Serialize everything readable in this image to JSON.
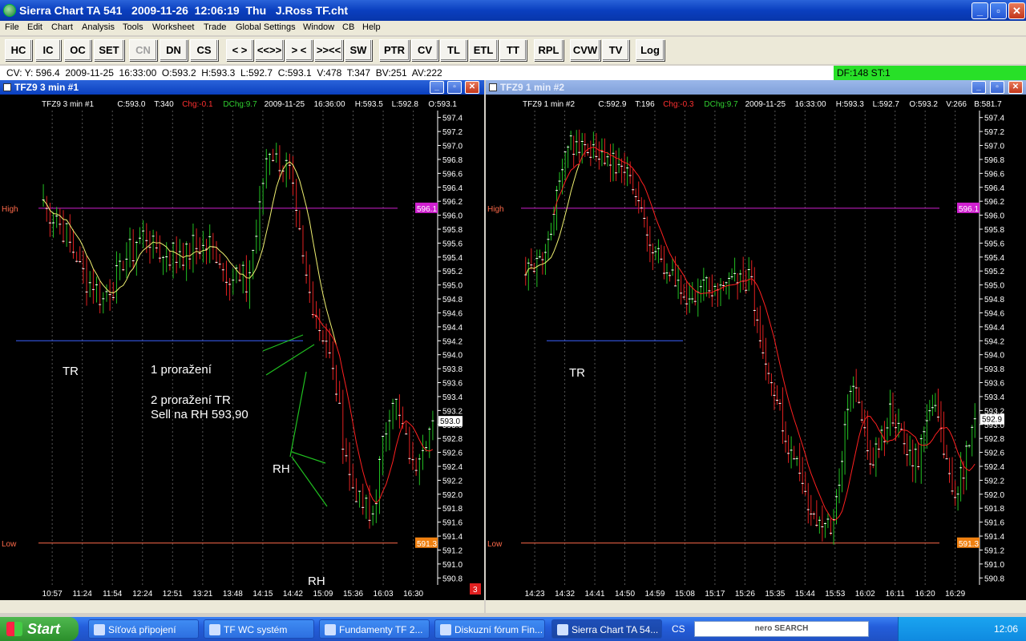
{
  "window": {
    "title": "Sierra Chart TA 541   2009-11-26  12:06:19  Thu   J.Ross TF.cht",
    "minimize": "_",
    "maximize": "▫",
    "close": "✕"
  },
  "menu": [
    "File",
    "Edit",
    "Chart",
    "Analysis",
    "Tools",
    "Worksheet",
    "Trade",
    "Global Settings",
    "Window",
    "CB",
    "Help"
  ],
  "toolbar": [
    "HC",
    "IC",
    "OC",
    "SET",
    "CN",
    "DN",
    "CS",
    "< >",
    "<<>>",
    "> <",
    ">><<",
    "SW",
    "PTR",
    "CV",
    "TL",
    "ETL",
    "TT",
    "RPL",
    "CVW",
    "TV",
    "Log"
  ],
  "cv_bar": {
    "text": "CV: Y: 596.4  2009-11-25  16:33:00  O:593.2  H:593.3  L:592.7  C:593.1  V:478  T:347  BV:251  AV:222",
    "df_st": "DF:148   ST:1"
  },
  "colors": {
    "up": "#22c022",
    "down": "#e02020",
    "ma_red": "#ff2020",
    "ma_yellow": "#f0f070",
    "high_line": "#d020d0",
    "low_line": "#ff6a4a",
    "tr_line": "#3a62ff"
  },
  "charts": [
    {
      "window_title": "TFZ9  3 min  #1",
      "header": {
        "sym": "TFZ9  3 min   #1",
        "c": "C:593.0",
        "t": "T:340",
        "chg": "Chg:-0.1",
        "dchg": "DChg:9.7",
        "date": "2009-11-25",
        "time": "16:36:00",
        "h": "H:593.5",
        "l": "L:592.8",
        "o": "O:593.1"
      },
      "labels": {
        "high": "High",
        "low": "Low",
        "high_tag": "596.1",
        "low_tag": "591.3",
        "last_tag": "593.0",
        "badge": "3"
      },
      "annotations": [
        "TR",
        "1 proražení",
        "2 proražení TR",
        "Sell  na RH 593,90",
        "RH",
        "RH"
      ],
      "chart_data": {
        "type": "candlestick",
        "y_ticks": [
          "597.4",
          "597.2",
          "597.0",
          "596.8",
          "596.6",
          "596.4",
          "596.2",
          "596.0",
          "595.8",
          "595.6",
          "595.4",
          "595.2",
          "595.0",
          "594.8",
          "594.6",
          "594.4",
          "594.2",
          "594.0",
          "593.8",
          "593.6",
          "593.4",
          "593.2",
          "593.0",
          "592.8",
          "592.6",
          "592.4",
          "592.2",
          "592.0",
          "591.8",
          "591.6",
          "591.4",
          "591.2",
          "591.0",
          "590.8"
        ],
        "x_ticks": [
          "10:57",
          "11:24",
          "11:54",
          "12:24",
          "12:51",
          "13:21",
          "13:48",
          "14:15",
          "14:42",
          "15:09",
          "15:36",
          "16:03",
          "16:30"
        ],
        "ylim": [
          590.7,
          597.5
        ],
        "high_line": 596.1,
        "low_line": 591.3,
        "tr_line": 594.2
      }
    },
    {
      "window_title": "TFZ9  1 min   #2",
      "header": {
        "sym": "TFZ9  1 min   #2",
        "c": "C:592.9",
        "t": "T:196",
        "chg": "Chg:-0.3",
        "dchg": "DChg:9.7",
        "date": "2009-11-25",
        "time": "16:33:00",
        "h": "H:593.3",
        "l": "L:592.7",
        "o": "O:593.2",
        "v": "V:266",
        "b": "B:581.7"
      },
      "labels": {
        "high": "High",
        "low": "Low",
        "high_tag": "596.1",
        "low_tag": "591.3",
        "last_tag": "592.9"
      },
      "annotations": [
        "TR"
      ],
      "chart_data": {
        "type": "candlestick",
        "y_ticks": [
          "597.4",
          "597.2",
          "597.0",
          "596.8",
          "596.6",
          "596.4",
          "596.2",
          "596.0",
          "595.8",
          "595.6",
          "595.4",
          "595.2",
          "595.0",
          "594.8",
          "594.6",
          "594.4",
          "594.2",
          "594.0",
          "593.8",
          "593.6",
          "593.4",
          "593.2",
          "593.0",
          "592.8",
          "592.6",
          "592.4",
          "592.2",
          "592.0",
          "591.8",
          "591.6",
          "591.4",
          "591.2",
          "591.0",
          "590.8"
        ],
        "x_ticks": [
          "14:23",
          "14:32",
          "14:41",
          "14:50",
          "14:59",
          "15:08",
          "15:17",
          "15:26",
          "15:35",
          "15:44",
          "15:53",
          "16:02",
          "16:11",
          "16:20",
          "16:29"
        ],
        "ylim": [
          590.7,
          597.5
        ],
        "high_line": 596.1,
        "low_line": 591.3,
        "tr_line": 594.2
      }
    }
  ],
  "taskbar": {
    "start": "Start",
    "tasks": [
      "Síťová připojení",
      "TF WC systém",
      "Fundamenty TF 2...",
      "Diskuzní fórum Fin...",
      "Sierra Chart TA 54..."
    ],
    "lang": "CS",
    "search": "nero SEARCH",
    "clock": "12:06"
  }
}
